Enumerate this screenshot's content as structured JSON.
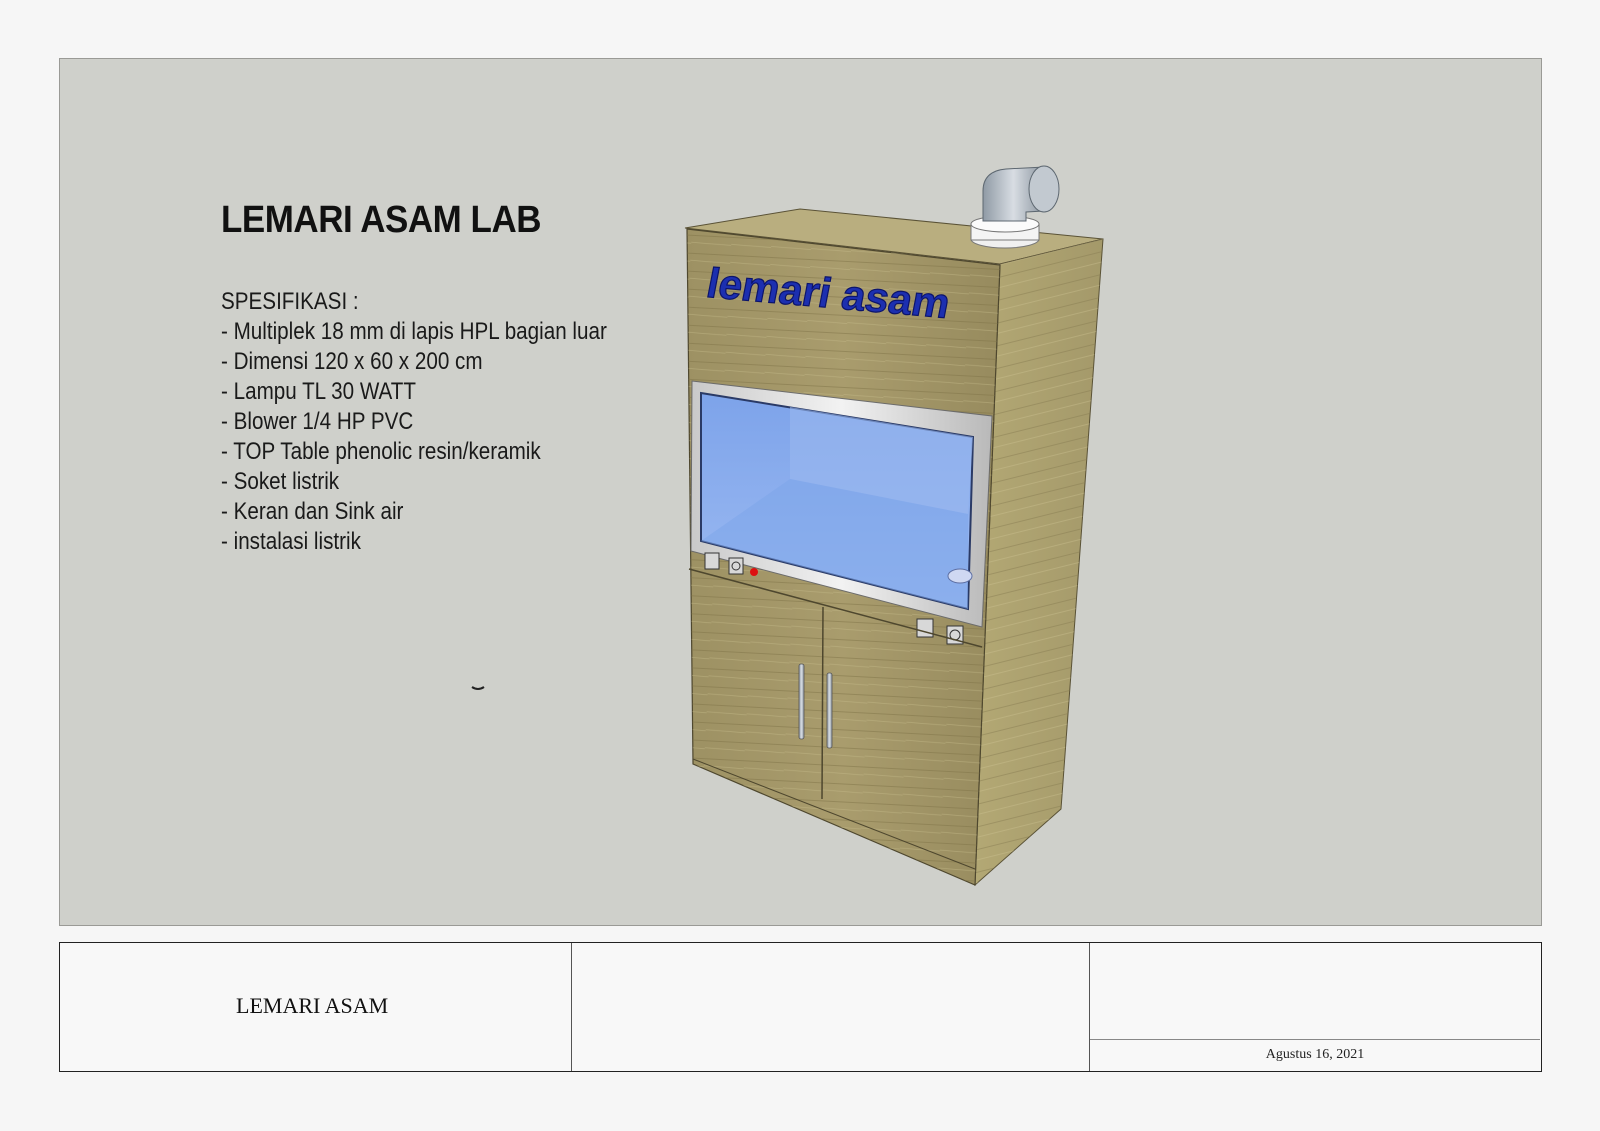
{
  "drawing": {
    "title": "LEMARI ASAM LAB",
    "spec_heading": "SPESIFIKASI :",
    "spec_items": [
      "- Multiplek 18 mm di lapis HPL bagian luar",
      "- Dimensi 120 x 60 x 200 cm",
      "- Lampu TL 30 WATT",
      "- Blower 1/4 HP PVC",
      "- TOP Table phenolic resin/keramik",
      "- Soket listrik",
      "- Keran dan Sink air",
      "- instalasi listrik"
    ],
    "cabinet_label": "lemari asam",
    "background_color": "#cfd0cb",
    "wood_color": "#a79a6a",
    "glass_color": "#86aef0",
    "label_color": "#1c2fb0"
  },
  "title_block": {
    "name": "LEMARI ASAM",
    "middle": "",
    "top_right": "",
    "date": "Agustus 16, 2021"
  }
}
